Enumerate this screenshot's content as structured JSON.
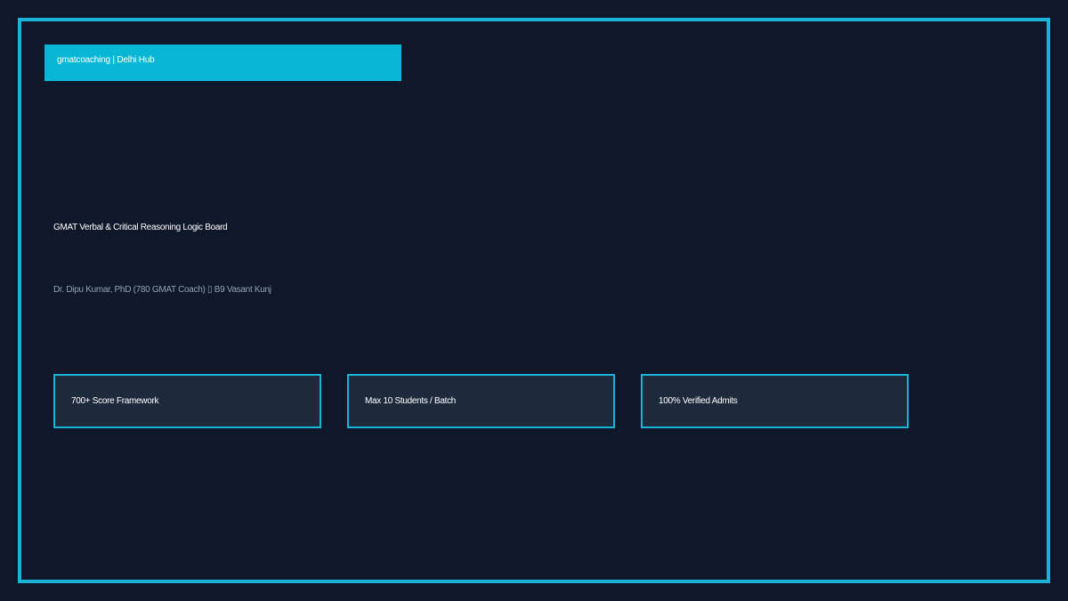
{
  "brand": {
    "label": "gmatcoaching | Delhi Hub"
  },
  "hero": {
    "title": "GMAT Verbal & Critical Reasoning Logic Board",
    "subtitle": "Dr. Dipu Kumar, PhD (780 GMAT Coach) ▯ B9 Vasant Kunj"
  },
  "features": [
    {
      "label": "700+ Score Framework"
    },
    {
      "label": "Max 10 Students / Batch"
    },
    {
      "label": "100% Verified Admits"
    }
  ],
  "colors": {
    "background": "#0f172a",
    "accent": "#06b6d4",
    "card": "#1e293b",
    "muted_text": "#94a3b8"
  }
}
